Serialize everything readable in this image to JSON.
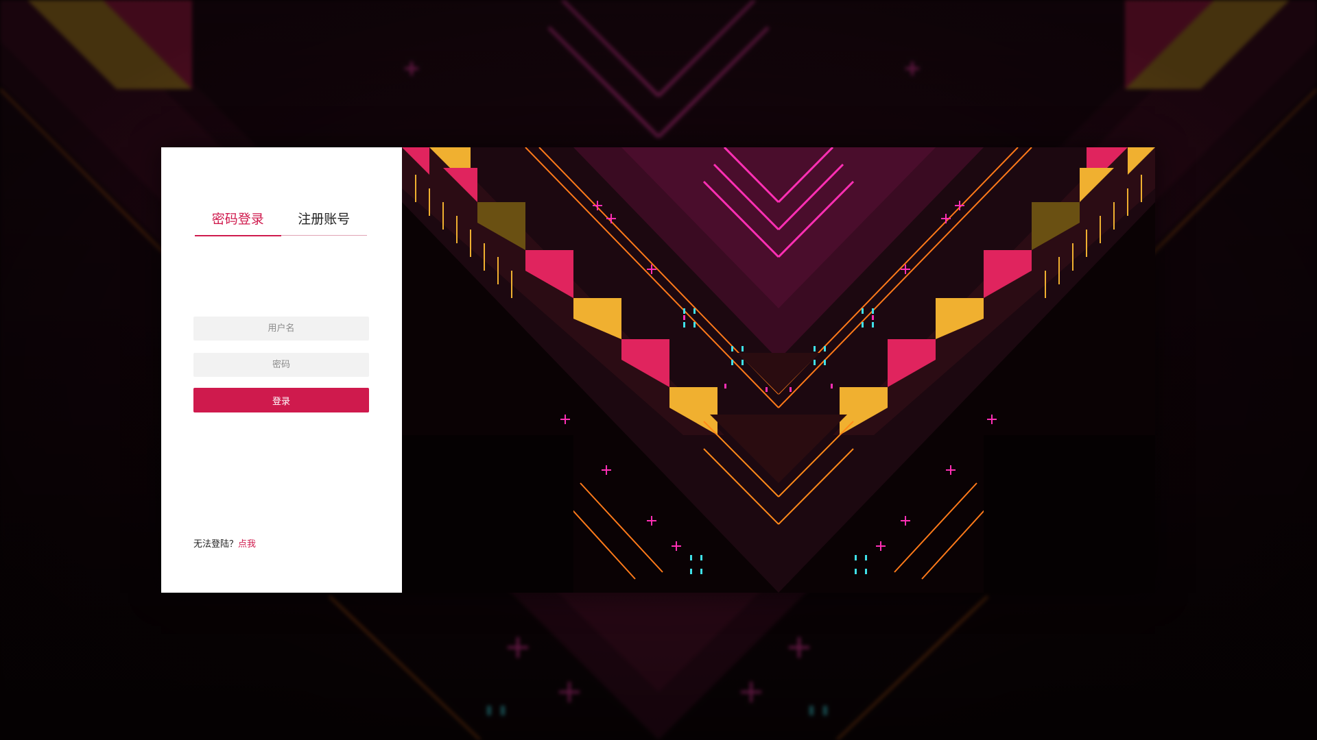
{
  "tabs": {
    "login_label": "密码登录",
    "register_label": "注册账号"
  },
  "form": {
    "username_placeholder": "用户名",
    "password_placeholder": "密码",
    "submit_label": "登录"
  },
  "help": {
    "text": "无法登陆？",
    "link_label": "点我"
  },
  "colors": {
    "accent": "#cf1a4d",
    "input_bg": "#f2f2f2",
    "panel_bg": "#ffffff",
    "page_bg": "#0b0306"
  },
  "icons": {
    "background_art": "neon-chevron-pattern"
  }
}
